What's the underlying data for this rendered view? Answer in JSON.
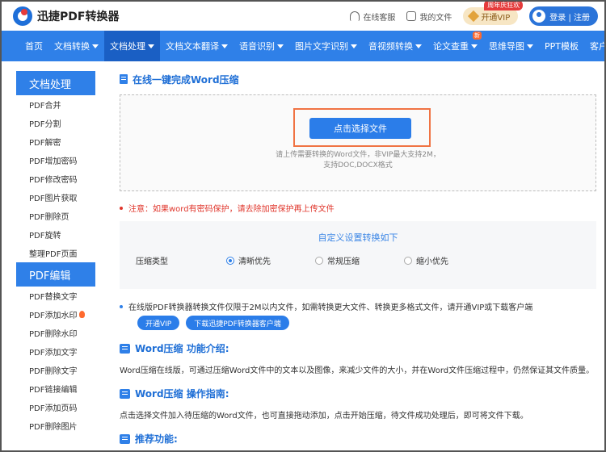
{
  "header": {
    "logo_text": "迅捷PDF转换器",
    "service_label": "在线客服",
    "files_label": "我的文件",
    "vip_label": "开通VIP",
    "vip_badge": "周年庆狂欢",
    "login_label": "登录 | 注册"
  },
  "nav": {
    "items": [
      {
        "label": "首页",
        "caret": false
      },
      {
        "label": "文档转换",
        "caret": true
      },
      {
        "label": "文档处理",
        "caret": true,
        "active": true
      },
      {
        "label": "文档文本翻译",
        "caret": true
      },
      {
        "label": "语音识别",
        "caret": true
      },
      {
        "label": "图片文字识别",
        "caret": true
      },
      {
        "label": "音视频转换",
        "caret": true
      },
      {
        "label": "论文查重",
        "caret": true,
        "badge": "新"
      },
      {
        "label": "思维导图",
        "caret": true
      },
      {
        "label": "PPT模板",
        "caret": false
      },
      {
        "label": "客户端",
        "caret": true
      }
    ]
  },
  "sidebar": {
    "group1_title": "文档处理",
    "group1_items": [
      "PDF合并",
      "PDF分割",
      "PDF解密",
      "PDF增加密码",
      "PDF修改密码",
      "PDF图片获取",
      "PDF删除页",
      "PDF旋转",
      "整理PDF页面"
    ],
    "group2_title": "PDF编辑",
    "group2_items": [
      "PDF替换文字",
      "PDF添加水印",
      "PDF删除水印",
      "PDF添加文字",
      "PDF删除文字",
      "PDF链接编辑",
      "PDF添加页码",
      "PDF删除图片"
    ]
  },
  "main": {
    "section_title": "在线一键完成Word压缩",
    "upload_button": "点击选择文件",
    "upload_tip_line1": "请上传需要转换的Word文件，非VIP最大支持2M，",
    "upload_tip_line2": "支持DOC,DOCX格式",
    "notice": "注意：如果word有密码保护，请去除加密保护再上传文件",
    "custom_title": "自定义设置转换如下",
    "option_label": "压缩类型",
    "options": [
      "清晰优先",
      "常规压缩",
      "缩小优先"
    ],
    "selected_option": "清晰优先",
    "info_text": "在线版PDF转换器转换文件仅限于2M以内文件，如需转换更大文件、转换更多格式文件，请开通VIP或下载客户端",
    "pill_vip": "开通VIP",
    "pill_download": "下载迅捷PDF转换器客户端",
    "intro_title": "Word压缩 功能介绍:",
    "intro_text": "Word压缩在线版，可通过压缩Word文件中的文本以及图像，来减少文件的大小，并在Word文件压缩过程中，仍然保证其文件质量。",
    "guide_title": "Word压缩 操作指南:",
    "guide_text": "点击选择文件加入待压缩的Word文件，也可直接拖动添加，点击开始压缩，待文件成功处理后，即可将文件下载。",
    "recommend_title": "推荐功能:"
  },
  "colors": {
    "brand_blue": "#2f80e8",
    "nav_active": "#1a5fc4",
    "highlight_frame": "#f07343",
    "notice_red": "#e0352b"
  }
}
